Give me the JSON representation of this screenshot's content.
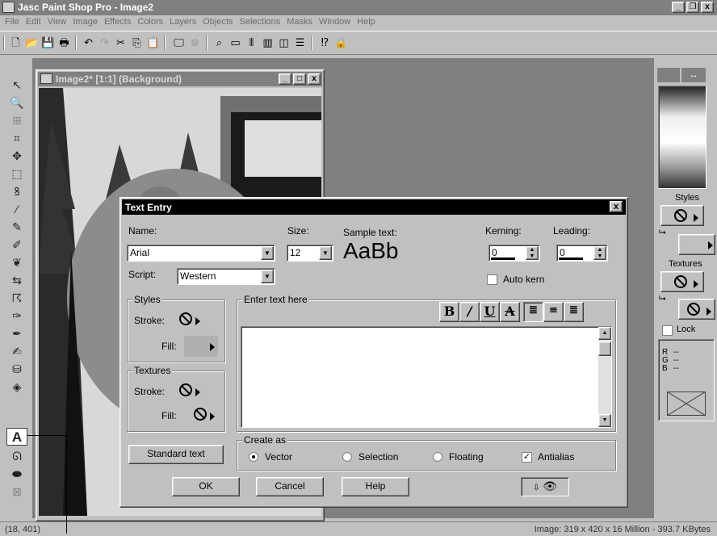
{
  "app": {
    "title": "Jasc Paint Shop Pro - Image2",
    "window_buttons": [
      "_",
      "❐",
      "x"
    ]
  },
  "menu": [
    "File",
    "Edit",
    "View",
    "Image",
    "Effects",
    "Colors",
    "Layers",
    "Objects",
    "Selections",
    "Masks",
    "Window",
    "Help"
  ],
  "toolbar_icons": [
    "new-icon",
    "open-icon",
    "save-icon",
    "print-icon",
    "undo-icon",
    "redo-icon",
    "cut-icon",
    "copy-icon",
    "paste-icon",
    "browse-icon",
    "layer-icon",
    "zoom-icon",
    "toggle-toolbar-icon",
    "toggle-palette-icon",
    "histogram-icon",
    "overview-icon",
    "controls-icon",
    "help-icon",
    "twain-icon"
  ],
  "tools": [
    "arrow-tool-icon",
    "zoom-tool-icon",
    "deformation-tool-icon",
    "crop-tool-icon",
    "mover-tool-icon",
    "selection-tool-icon",
    "freehand-tool-icon",
    "dropper-tool-icon",
    "paintbrush-tool-icon",
    "clone-tool-icon",
    "color-replacer-icon",
    "retouch-tool-icon",
    "scratch-remover-icon",
    "eraser-tool-icon",
    "picture-tube-icon",
    "airbrush-icon",
    "flood-fill-icon",
    "text-tool-icon",
    "draw-tool-icon",
    "preset-shapes-icon",
    "object-selector-icon"
  ],
  "image_window": {
    "title": "Image2* [1:1] (Background)",
    "buttons": [
      "_",
      "□",
      "x"
    ]
  },
  "right_palette": {
    "styles_label": "Styles",
    "textures_label": "Textures",
    "lock_label": "Lock",
    "r_label": "R",
    "g_label": "G",
    "b_label": "B",
    "r_value": "--",
    "g_value": "--",
    "b_value": "--",
    "swap_icon": "↔"
  },
  "dialog": {
    "title": "Text Entry",
    "close": "x",
    "name_label": "Name:",
    "name_value": "Arial",
    "size_label": "Size:",
    "size_value": "12",
    "sample_label": "Sample text:",
    "sample_text": "AaBb",
    "kerning_label": "Kerning:",
    "kerning_value": "0",
    "leading_label": "Leading:",
    "leading_value": "0",
    "script_label": "Script:",
    "script_value": "Western",
    "auto_kern_label": "Auto kern",
    "styles_group": "Styles",
    "stroke_label": "Stroke:",
    "fill_label": "Fill:",
    "textures_group": "Textures",
    "enter_text_group": "Enter text here",
    "format_buttons": [
      "B",
      "/",
      "U",
      "A"
    ],
    "text_value": "",
    "standard_text_button": "Standard text",
    "create_as_group": "Create as",
    "create_options": [
      "Vector",
      "Selection",
      "Floating"
    ],
    "create_selected": "Vector",
    "antialias_label": "Antialias",
    "antialias_checked": true,
    "ok_button": "OK",
    "cancel_button": "Cancel",
    "help_button": "Help"
  },
  "status": {
    "coords": "(18, 401)",
    "image_info": "Image:  319 x 420 x 16 Million - 393.7 KBytes"
  }
}
